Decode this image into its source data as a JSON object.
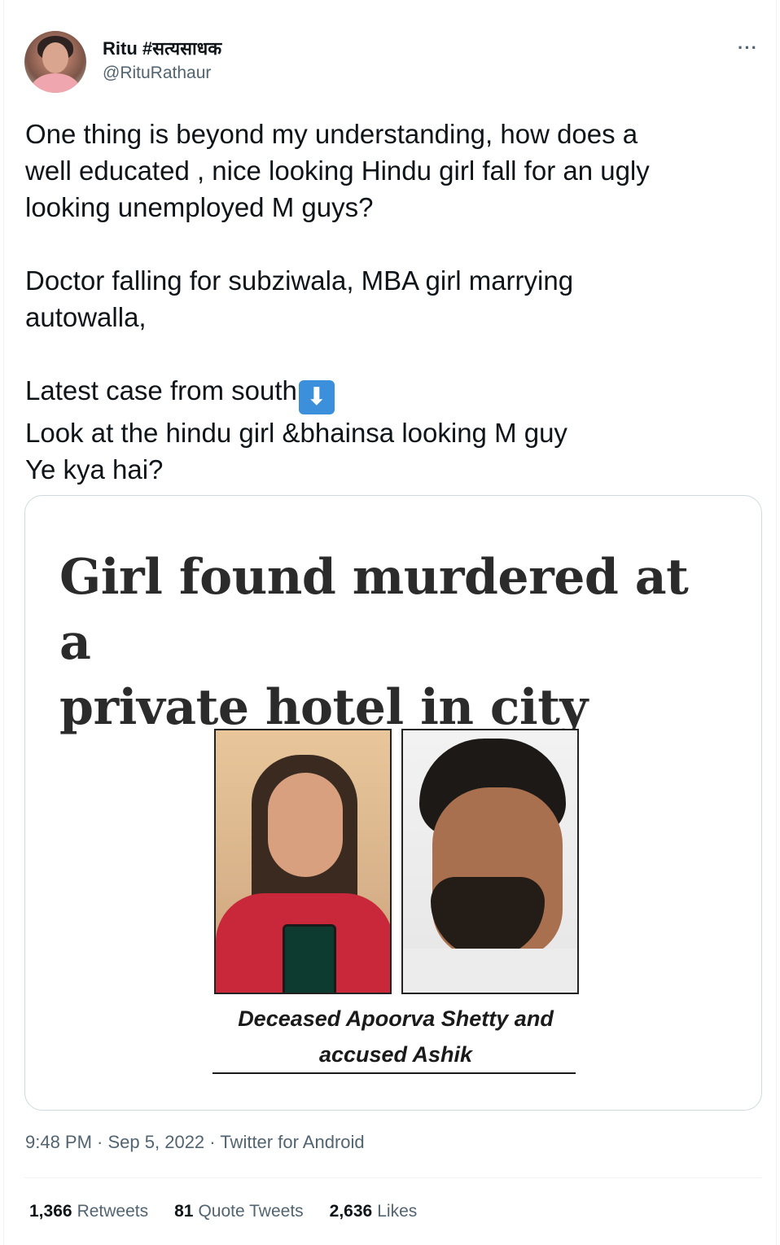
{
  "author": {
    "display_name": "Ritu #सत्यसाधक",
    "handle": "@RituRathaur"
  },
  "more_icon": "···",
  "tweet": {
    "line1": "One thing is beyond my understanding, how does a",
    "line2": "well educated , nice looking Hindu girl fall for an ugly",
    "line3": "looking unemployed M guys?",
    "line4": "Doctor falling for subziwala, MBA girl marrying",
    "line5": "autowalla,",
    "line6": "Latest case from south",
    "emoji": "⬇",
    "line7": "Look at the hindu girl &bhainsa looking M guy",
    "line8": "Ye kya hai?"
  },
  "media": {
    "headline_line1": "Girl found murdered at a",
    "headline_line2": "private hotel in city",
    "caption_line1": "Deceased Apoorva Shetty and",
    "caption_line2": "accused Ashik"
  },
  "meta": {
    "time": "9:48 PM",
    "sep1": " · ",
    "date": "Sep 5, 2022",
    "sep2": " · ",
    "source": "Twitter for Android"
  },
  "stats": {
    "retweets_count": "1,366",
    "retweets_label": "Retweets",
    "quotes_count": "81",
    "quotes_label": "Quote Tweets",
    "likes_count": "2,636",
    "likes_label": "Likes"
  },
  "colors": {
    "text": "#0f1419",
    "secondary": "#536471",
    "border": "#cfd9de"
  }
}
